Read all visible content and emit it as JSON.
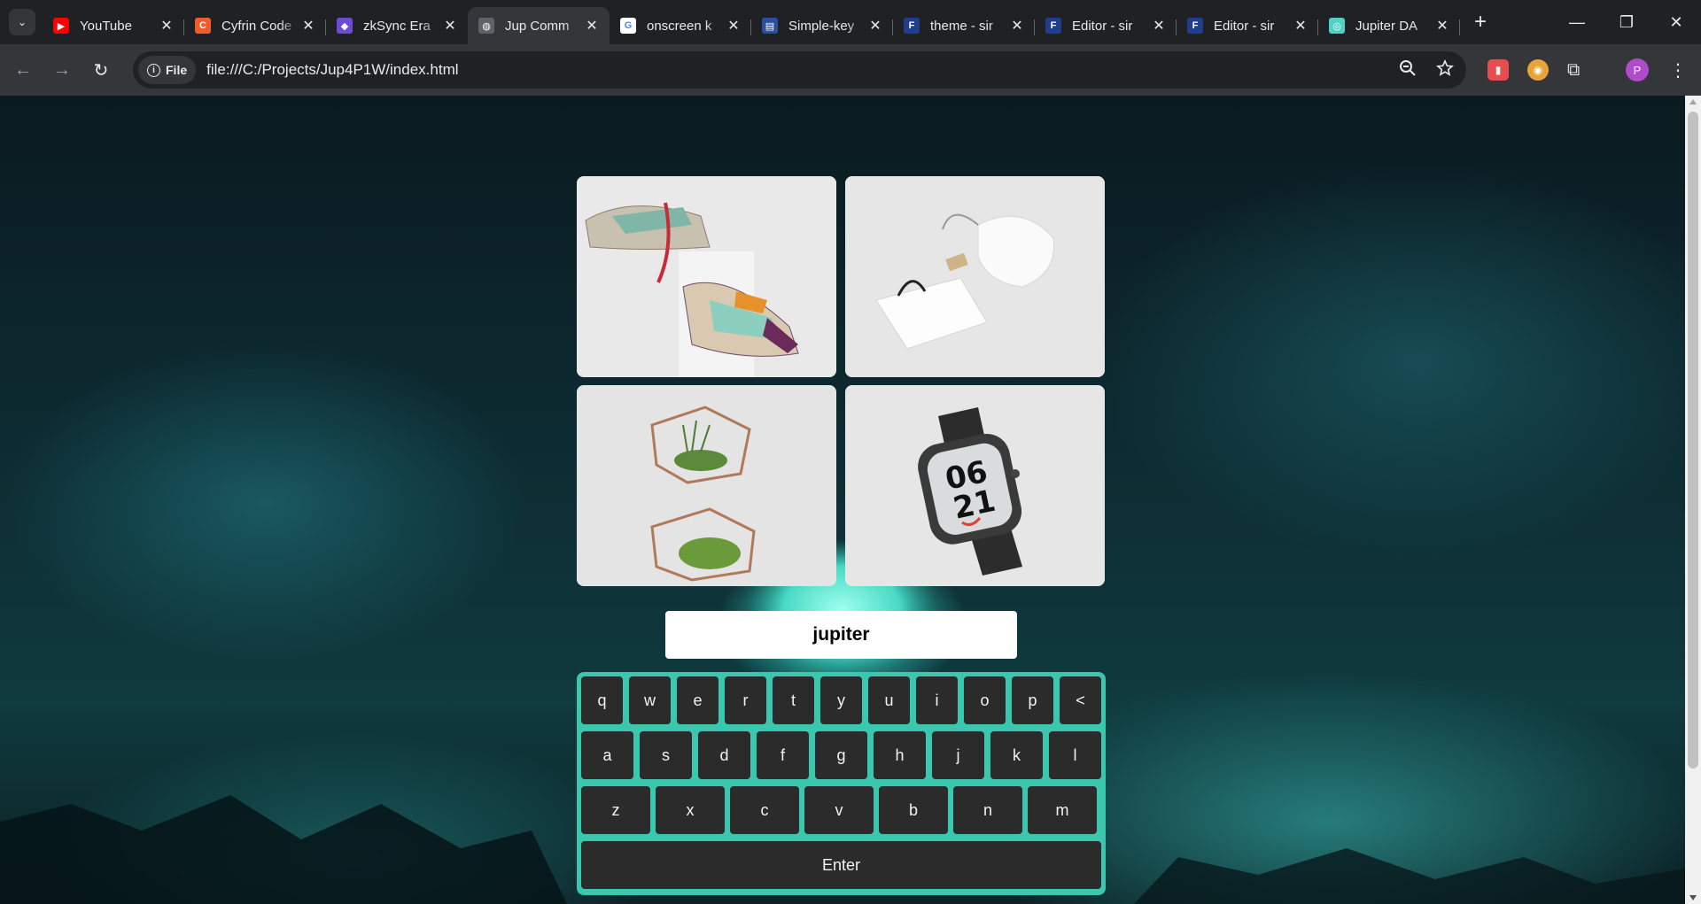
{
  "browser": {
    "tabs": [
      {
        "title": "YouTube",
        "favicon": "youtube-icon",
        "color": "#ff0000",
        "glyph": "▶",
        "active": false
      },
      {
        "title": "Cyfrin Code",
        "favicon": "cyfrin-icon",
        "color": "#f25c2a",
        "glyph": "C",
        "active": false
      },
      {
        "title": "zkSync Era",
        "favicon": "zksync-icon",
        "color": "#6c4bd6",
        "glyph": "◆",
        "active": false
      },
      {
        "title": "Jup Comm",
        "favicon": "globe-icon",
        "color": "#5f6368",
        "glyph": "◍",
        "active": true
      },
      {
        "title": "onscreen k",
        "favicon": "google-icon",
        "color": "#ffffff",
        "glyph": "G",
        "active": false
      },
      {
        "title": "Simple-key",
        "favicon": "simple-keyboard-icon",
        "color": "#2b4f9e",
        "glyph": "▤",
        "active": false
      },
      {
        "title": "theme - sir",
        "favicon": "framer-icon",
        "color": "#1f3f8a",
        "glyph": "F",
        "active": false
      },
      {
        "title": "Editor - sir",
        "favicon": "framer-icon",
        "color": "#1f3f8a",
        "glyph": "F",
        "active": false
      },
      {
        "title": "Editor - sir",
        "favicon": "framer-icon",
        "color": "#1f3f8a",
        "glyph": "F",
        "active": false
      },
      {
        "title": "Jupiter DA",
        "favicon": "jupiter-icon",
        "color": "#4fd1c5",
        "glyph": "◎",
        "active": false
      }
    ],
    "file_chip": "File",
    "url": "file:///C:/Projects/Jup4P1W/index.html",
    "avatar_letter": "P"
  },
  "page": {
    "images": [
      {
        "name": "sneakers-image",
        "alt": "sneakers"
      },
      {
        "name": "bags-image",
        "alt": "bags"
      },
      {
        "name": "planters-image",
        "alt": "planters"
      },
      {
        "name": "watch-image",
        "alt": "watch"
      }
    ],
    "watch_face": [
      "06",
      "21"
    ],
    "input_value": "jupiter",
    "keyboard": {
      "row1": [
        "q",
        "w",
        "e",
        "r",
        "t",
        "y",
        "u",
        "i",
        "o",
        "p",
        "<"
      ],
      "row2": [
        "a",
        "s",
        "d",
        "f",
        "g",
        "h",
        "j",
        "k",
        "l"
      ],
      "row3": [
        "z",
        "x",
        "c",
        "v",
        "b",
        "n",
        "m"
      ],
      "enter": "Enter",
      "frame_color": "#3ac7ae",
      "key_color": "#2b2b2b"
    }
  }
}
